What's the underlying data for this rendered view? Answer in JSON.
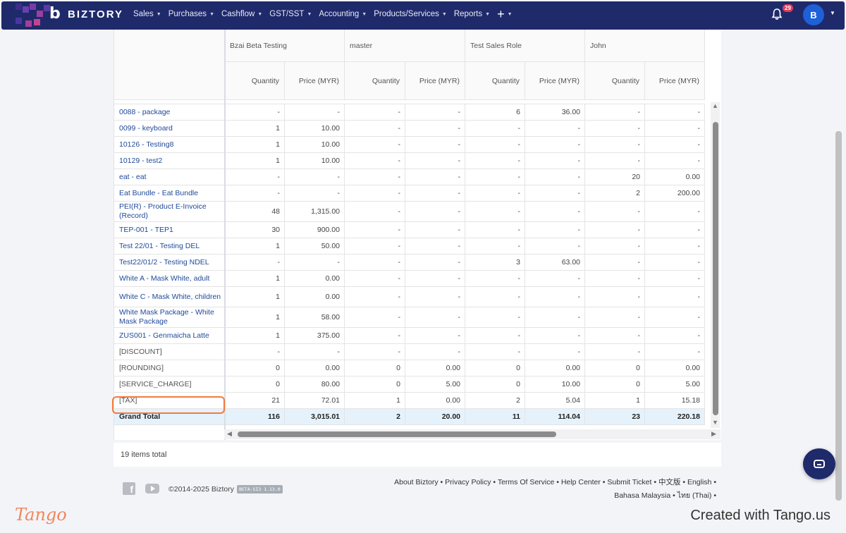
{
  "brand": {
    "name": "BIZTORY",
    "logo_letter": "b"
  },
  "nav": {
    "items": [
      {
        "label": "Sales"
      },
      {
        "label": "Purchases"
      },
      {
        "label": "Cashflow"
      },
      {
        "label": "GST/SST"
      },
      {
        "label": "Accounting"
      },
      {
        "label": "Products/Services"
      },
      {
        "label": "Reports"
      }
    ],
    "add_label": "+",
    "notifications_count": "29",
    "avatar_initial": "B"
  },
  "table": {
    "groups": [
      "Bzai Beta Testing",
      "master",
      "Test Sales Role",
      "John"
    ],
    "subheaders": [
      "Quantity",
      "Price (MYR)"
    ],
    "rows": [
      {
        "name": "0088 - package",
        "vals": [
          "-",
          "-",
          "-",
          "-",
          "6",
          "36.00",
          "-",
          "-"
        ]
      },
      {
        "name": "0099 - keyboard",
        "vals": [
          "1",
          "10.00",
          "-",
          "-",
          "-",
          "-",
          "-",
          "-"
        ]
      },
      {
        "name": "10126 - Testing8",
        "vals": [
          "1",
          "10.00",
          "-",
          "-",
          "-",
          "-",
          "-",
          "-"
        ]
      },
      {
        "name": "10129 - test2",
        "vals": [
          "1",
          "10.00",
          "-",
          "-",
          "-",
          "-",
          "-",
          "-"
        ]
      },
      {
        "name": "eat - eat",
        "vals": [
          "-",
          "-",
          "-",
          "-",
          "-",
          "-",
          "20",
          "0.00"
        ]
      },
      {
        "name": "Eat Bundle - Eat Bundle",
        "vals": [
          "-",
          "-",
          "-",
          "-",
          "-",
          "-",
          "2",
          "200.00"
        ]
      },
      {
        "name": "PEI(R) - Product E-Invoice (Record)",
        "vals": [
          "48",
          "1,315.00",
          "-",
          "-",
          "-",
          "-",
          "-",
          "-"
        ]
      },
      {
        "name": "TEP-001 - TEP1",
        "vals": [
          "30",
          "900.00",
          "-",
          "-",
          "-",
          "-",
          "-",
          "-"
        ]
      },
      {
        "name": "Test 22/01 - Testing DEL",
        "vals": [
          "1",
          "50.00",
          "-",
          "-",
          "-",
          "-",
          "-",
          "-"
        ]
      },
      {
        "name": "Test22/01/2 - Testing NDEL",
        "vals": [
          "-",
          "-",
          "-",
          "-",
          "3",
          "63.00",
          "-",
          "-"
        ]
      },
      {
        "name": "White A - Mask White, adult",
        "vals": [
          "1",
          "0.00",
          "-",
          "-",
          "-",
          "-",
          "-",
          "-"
        ]
      },
      {
        "name": "White C - Mask White, children",
        "vals": [
          "1",
          "0.00",
          "-",
          "-",
          "-",
          "-",
          "-",
          "-"
        ]
      },
      {
        "name": "White Mask Package - White Mask Package",
        "vals": [
          "1",
          "58.00",
          "-",
          "-",
          "-",
          "-",
          "-",
          "-"
        ]
      },
      {
        "name": "ZUS001 - Genmaicha Latte",
        "vals": [
          "1",
          "375.00",
          "-",
          "-",
          "-",
          "-",
          "-",
          "-"
        ]
      },
      {
        "name": "[DISCOUNT]",
        "vals": [
          "-",
          "-",
          "-",
          "-",
          "-",
          "-",
          "-",
          "-"
        ]
      },
      {
        "name": "[ROUNDING]",
        "vals": [
          "0",
          "0.00",
          "0",
          "0.00",
          "0",
          "0.00",
          "0",
          "0.00"
        ]
      },
      {
        "name": "[SERVICE_CHARGE]",
        "vals": [
          "0",
          "80.00",
          "0",
          "5.00",
          "0",
          "10.00",
          "0",
          "5.00"
        ]
      },
      {
        "name": "[TAX]",
        "vals": [
          "21",
          "72.01",
          "1",
          "0.00",
          "2",
          "5.04",
          "1",
          "15.18"
        ]
      }
    ],
    "total": {
      "name": "Grand Total",
      "vals": [
        "116",
        "3,015.01",
        "2",
        "20.00",
        "11",
        "114.04",
        "23",
        "220.18"
      ]
    }
  },
  "items_total": "19 items total",
  "footer": {
    "copyright": "©2014-2025 Biztory",
    "version": "BETA-SI3 1.13.0",
    "links": [
      "About Biztory",
      "Privacy Policy",
      "Terms Of Service",
      "Help Center",
      "Submit Ticket",
      "中文版",
      "English",
      "Bahasa Malaysia",
      "ไทย (Thai)"
    ]
  },
  "watermark": {
    "logo": "Tango",
    "credit": "Created with Tango.us"
  },
  "colors": {
    "nav": "#1f2a6b",
    "highlight": "#f47a3a",
    "total_row": "#e6f2fb",
    "link": "#214a9b"
  }
}
